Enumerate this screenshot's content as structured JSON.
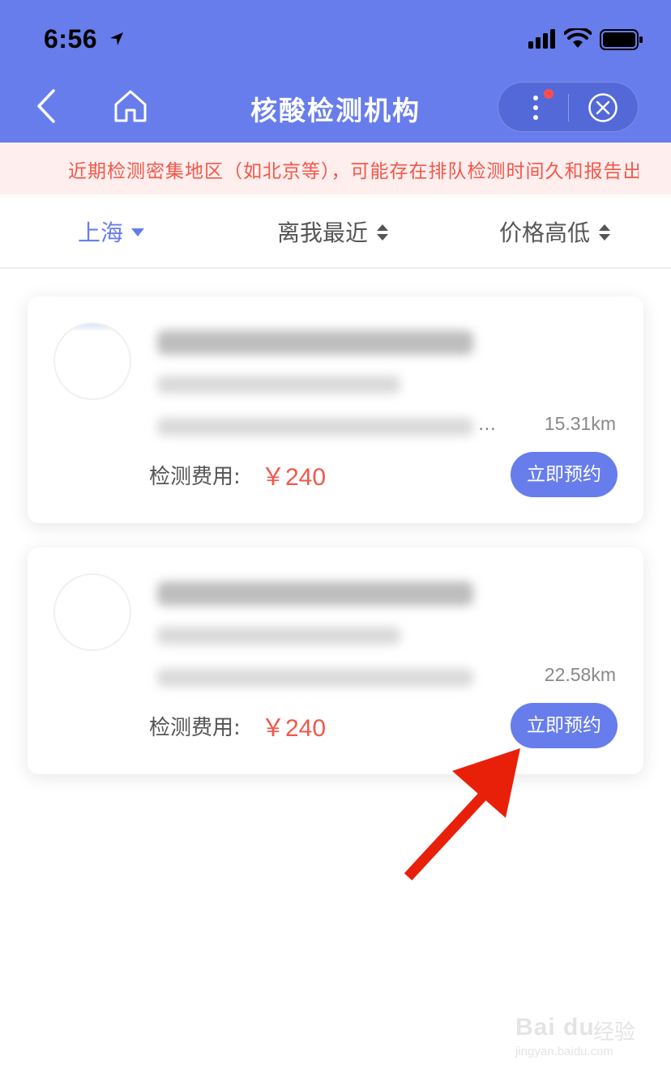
{
  "status_bar": {
    "time": "6:56"
  },
  "nav": {
    "title": "核酸检测机构"
  },
  "notice": {
    "text": "近期检测密集地区（如北京等），可能存在排队检测时间久和报告出"
  },
  "filters": [
    {
      "label": "上海"
    },
    {
      "label": "离我最近"
    },
    {
      "label": "价格高低"
    }
  ],
  "institutions": [
    {
      "distance": "15.31km",
      "fee_label": "检测费用:",
      "fee_value": "￥240",
      "book_label": "立即预约",
      "ellipsis": "…"
    },
    {
      "distance": "22.58km",
      "fee_label": "检测费用:",
      "fee_value": "￥240",
      "book_label": "立即预约"
    }
  ],
  "watermark": {
    "logo": "Bai du",
    "cn": "经验",
    "url": "jingyan.baidu.com"
  },
  "colors": {
    "primary": "#677deb",
    "price": "#f2574a",
    "notice_bg": "#feeeed",
    "arrow": "#e8200a"
  }
}
